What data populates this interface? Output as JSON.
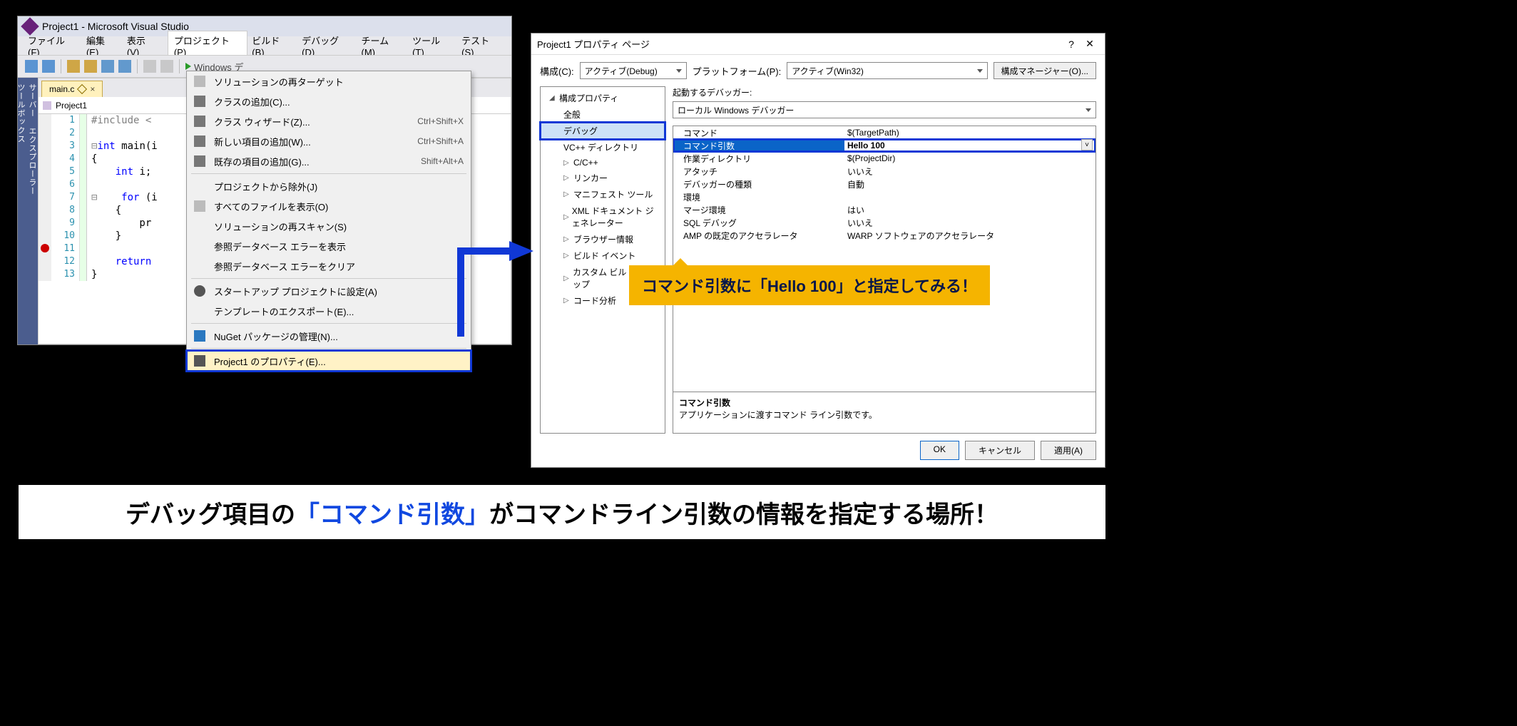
{
  "vs": {
    "title": "Project1 - Microsoft Visual Studio",
    "menu": {
      "file": "ファイル(F)",
      "edit": "編集(E)",
      "view": "表示(V)",
      "project": "プロジェクト(P)",
      "build": "ビルド(B)",
      "debug": "デバッグ(D)",
      "team": "チーム(M)",
      "tools": "ツール(T)",
      "test": "テスト(S)"
    },
    "toolbar": {
      "attach": "Windows デ"
    },
    "sidetabs": {
      "a": "サーバー エクスプローラー",
      "b": "ツールボックス"
    },
    "tab": {
      "file": "main.c"
    },
    "scope": "Project1",
    "lines": [
      "1",
      "2",
      "3",
      "4",
      "5",
      "6",
      "7",
      "8",
      "9",
      "10",
      "11",
      "12",
      "13"
    ],
    "src": {
      "l1a": "#include <",
      "l3a": "int ",
      "l3b": "main(i",
      "l4": "{",
      "l5a": "    int ",
      "l5b": "i;",
      "l7a": "    for ",
      "l7b": "(i",
      "l8": "    {",
      "l9": "        pr",
      "l10": "    }",
      "l12a": "    return",
      "l13": "}"
    },
    "ctx": {
      "retarget": "ソリューションの再ターゲット",
      "addclass": "クラスの追加(C)...",
      "classwiz": "クラス ウィザード(Z)...",
      "classwiz_k": "Ctrl+Shift+X",
      "newitem": "新しい項目の追加(W)...",
      "newitem_k": "Ctrl+Shift+A",
      "existitem": "既存の項目の追加(G)...",
      "existitem_k": "Shift+Alt+A",
      "exclude": "プロジェクトから除外(J)",
      "showall": "すべてのファイルを表示(O)",
      "rescan": "ソリューションの再スキャン(S)",
      "dbshow": "参照データベース エラーを表示",
      "dbclear": "参照データベース エラーをクリア",
      "startup": "スタートアップ プロジェクトに設定(A)",
      "exporttmpl": "テンプレートのエクスポート(E)...",
      "nuget": "NuGet パッケージの管理(N)...",
      "props": "Project1 のプロパティ(E)..."
    }
  },
  "pp": {
    "title": "Project1 プロパティ ページ",
    "cfg_lbl": "構成(C):",
    "cfg_val": "アクティブ(Debug)",
    "plat_lbl": "プラットフォーム(P):",
    "plat_val": "アクティブ(Win32)",
    "mgr_btn": "構成マネージャー(O)...",
    "tree": {
      "root": "構成プロパティ",
      "general": "全般",
      "debug": "デバッグ",
      "vcdir": "VC++ ディレクトリ",
      "cc": "C/C++",
      "linker": "リンカー",
      "manifest": "マニフェスト ツール",
      "xml": "XML ドキュメント ジェネレーター",
      "browse": "ブラウザー情報",
      "buildev": "ビルド イベント",
      "custom": "カスタム ビルド ステップ",
      "codean": "コード分析"
    },
    "right": {
      "hdr": "起動するデバッガー:",
      "debugger": "ローカル Windows デバッガー",
      "rows": {
        "cmd": "コマンド",
        "cmd_v": "$(TargetPath)",
        "args": "コマンド引数",
        "args_v": "Hello 100",
        "wdir": "作業ディレクトリ",
        "wdir_v": "$(ProjectDir)",
        "attach": "アタッチ",
        "attach_v": "いいえ",
        "dbgtype": "デバッガーの種類",
        "dbgtype_v": "自動",
        "env": "環境",
        "env_v": "",
        "merge": "マージ環境",
        "merge_v": "はい",
        "sql": "SQL デバッグ",
        "sql_v": "いいえ",
        "amp": "AMP の既定のアクセラレータ",
        "amp_v": "WARP ソフトウェアのアクセラレータ"
      },
      "desc_t": "コマンド引数",
      "desc_b": "アプリケーションに渡すコマンド ライン引数です。"
    },
    "buttons": {
      "ok": "OK",
      "cancel": "キャンセル",
      "apply": "適用(A)"
    }
  },
  "callout": "コマンド引数に「Hello 100」と指定してみる！",
  "caption": {
    "pre": "デバッグ項目の",
    "blue": "「コマンド引数」",
    "post": "がコマンドライン引数の情報を指定する場所！"
  }
}
